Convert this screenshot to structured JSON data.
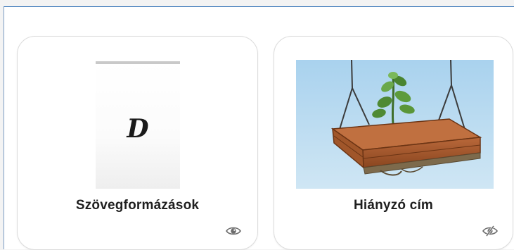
{
  "cards": [
    {
      "title": "Szövegformázások",
      "thumbnail_icon": "document-letter-d-thumbnail",
      "thumbnail_letter": "D",
      "visibility_icon": "eye-icon",
      "visibility": "visible"
    },
    {
      "title": "Hiányzó cím",
      "thumbnail_icon": "hanging-planter-thumbnail",
      "visibility_icon": "eye-slash-icon",
      "visibility": "hidden"
    }
  ],
  "colors": {
    "panel_border": "#2f6fb5",
    "card_border": "#dcdcdc",
    "sky": "#b9d9ee",
    "wood": "#a0562a"
  }
}
